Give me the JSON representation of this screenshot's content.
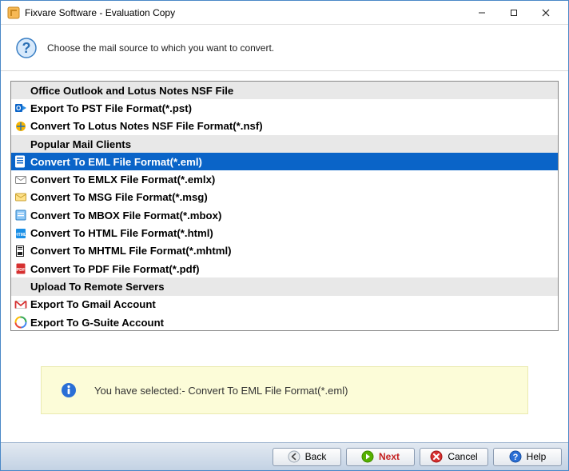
{
  "window": {
    "title": "Fixvare Software - Evaluation Copy"
  },
  "header": {
    "prompt": "Choose the mail source to which you want to convert."
  },
  "list": [
    {
      "type": "header",
      "label": "Office Outlook and Lotus Notes NSF File"
    },
    {
      "type": "item",
      "icon": "outlook",
      "label": "Export To PST File Format(*.pst)"
    },
    {
      "type": "item",
      "icon": "lotus",
      "label": "Convert To Lotus Notes NSF File Format(*.nsf)"
    },
    {
      "type": "header",
      "label": "Popular Mail Clients"
    },
    {
      "type": "item",
      "icon": "eml",
      "label": "Convert To EML File Format(*.eml)",
      "selected": true
    },
    {
      "type": "item",
      "icon": "emlx",
      "label": "Convert To EMLX File Format(*.emlx)"
    },
    {
      "type": "item",
      "icon": "msg",
      "label": "Convert To MSG File Format(*.msg)"
    },
    {
      "type": "item",
      "icon": "mbox",
      "label": "Convert To MBOX File Format(*.mbox)"
    },
    {
      "type": "item",
      "icon": "html",
      "label": "Convert To HTML File Format(*.html)"
    },
    {
      "type": "item",
      "icon": "mhtml",
      "label": "Convert To MHTML File Format(*.mhtml)"
    },
    {
      "type": "item",
      "icon": "pdf",
      "label": "Convert To PDF File Format(*.pdf)"
    },
    {
      "type": "header",
      "label": "Upload To Remote Servers"
    },
    {
      "type": "item",
      "icon": "gmail",
      "label": "Export To Gmail Account"
    },
    {
      "type": "item",
      "icon": "gsuite",
      "label": "Export To G-Suite Account"
    }
  ],
  "status": {
    "text": "You have selected:- Convert To EML File Format(*.eml)"
  },
  "footer": {
    "back": "Back",
    "next": "Next",
    "cancel": "Cancel",
    "help": "Help"
  },
  "colors": {
    "selection": "#0a64c8",
    "footer_grad_top": "#e2e9f1",
    "status_bg": "#fcfcd8"
  }
}
